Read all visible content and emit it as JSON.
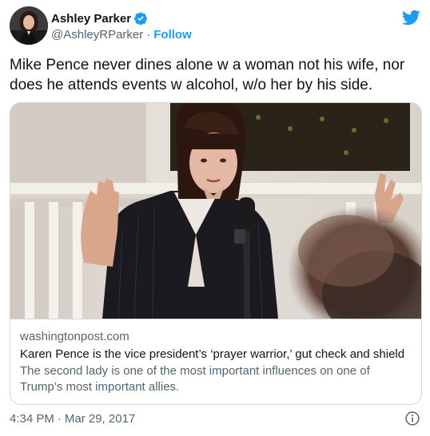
{
  "author": {
    "name": "Ashley Parker",
    "handle": "@AshleyRParker",
    "separator": "·",
    "follow_label": "Follow"
  },
  "tweet": {
    "text": "Mike Pence never dines alone w a woman not his wife, nor does he attends events w alcohol, w/o her by his side."
  },
  "card": {
    "domain": "washingtonpost.com",
    "title": "Karen Pence is the vice president’s ‘prayer warrior,’ gut check and shield",
    "description": "The second lady is one of the most important influences on one of Trump’s most important allies."
  },
  "meta": {
    "time": "4:34 PM",
    "separator": "·",
    "date": "Mar 29, 2017"
  },
  "colors": {
    "accent": "#1d9bf0",
    "text_primary": "#0f1419",
    "text_secondary": "#536471",
    "border": "#cfd9de"
  },
  "icons": {
    "verified": "verified-badge-icon",
    "logo": "twitter-bird-icon",
    "info": "info-icon"
  }
}
